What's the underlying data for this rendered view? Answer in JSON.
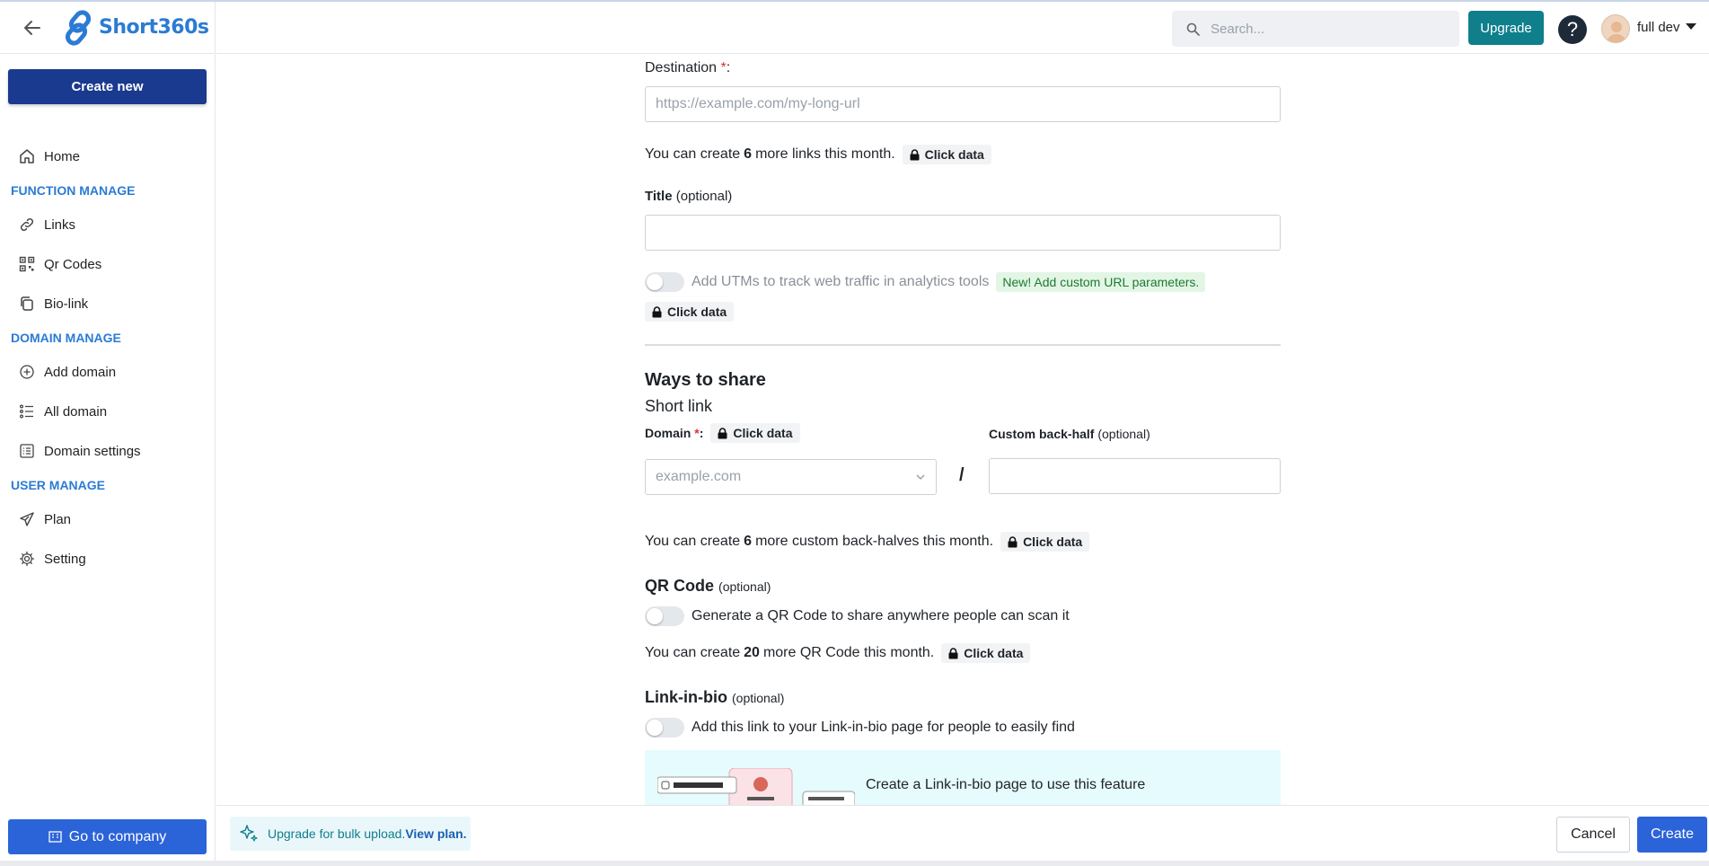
{
  "app": {
    "name": "Short360s"
  },
  "sidebar": {
    "create_new": "Create new",
    "go_company": "Go to company",
    "items": [
      {
        "type": "item",
        "label": "Home",
        "icon": "home-icon"
      },
      {
        "type": "section",
        "label": "FUNCTION MANAGE"
      },
      {
        "type": "item",
        "label": "Links",
        "icon": "link-icon"
      },
      {
        "type": "item",
        "label": "Qr Codes",
        "icon": "qr-icon"
      },
      {
        "type": "item",
        "label": "Bio-link",
        "icon": "copy-icon"
      },
      {
        "type": "section",
        "label": "DOMAIN MANAGE"
      },
      {
        "type": "item",
        "label": "Add domain",
        "icon": "plus-circle-icon"
      },
      {
        "type": "item",
        "label": "All domain",
        "icon": "list-icon"
      },
      {
        "type": "item",
        "label": "Domain settings",
        "icon": "settings-list-icon"
      },
      {
        "type": "section",
        "label": "USER MANAGE"
      },
      {
        "type": "item",
        "label": "Plan",
        "icon": "send-icon"
      },
      {
        "type": "item",
        "label": "Setting",
        "icon": "gear-icon"
      }
    ]
  },
  "header": {
    "search_placeholder": "Search...",
    "upgrade": "Upgrade",
    "help": "?",
    "user_name": "full dev"
  },
  "form": {
    "destination_label": "Destination",
    "required_mark": "*",
    "colon": ":",
    "destination_placeholder": "https://example.com/my-long-url",
    "links_info_pre": "You can create",
    "links_count": "6",
    "links_info_post": "more links this month.",
    "click_data": "Click data",
    "title_label": "Title",
    "optional": "(optional)",
    "utm_text": "Add UTMs to track web traffic in analytics tools",
    "utm_badge": "New! Add custom URL parameters.",
    "ways_to_share": "Ways to share",
    "short_link": "Short link",
    "domain_label": "Domain",
    "domain_placeholder": "example.com",
    "slash": "/",
    "back_half_label": "Custom back-half",
    "backhalf_info_pre": "You can create",
    "backhalf_count": "6",
    "backhalf_info_post": "more custom back-halves this month.",
    "qr_title": "QR Code",
    "qr_toggle_text": "Generate a QR Code to share anywhere people can scan it",
    "qr_info_pre": "You can create",
    "qr_count": "20",
    "qr_info_post": "more QR Code this month.",
    "bio_title": "Link-in-bio",
    "bio_toggle_text": "Add this link to your Link-in-bio page for people to easily find",
    "bio_card_text": "Create a Link-in-bio page to use this feature"
  },
  "footer": {
    "bulk_text": "Upgrade for bulk upload.",
    "bulk_link": "View plan.",
    "cancel": "Cancel",
    "create": "Create"
  },
  "colors": {
    "brand": "#2b7bd4",
    "primary": "#1a3a8f",
    "teal": "#0f7f8c",
    "button_blue": "#2b63d9"
  }
}
